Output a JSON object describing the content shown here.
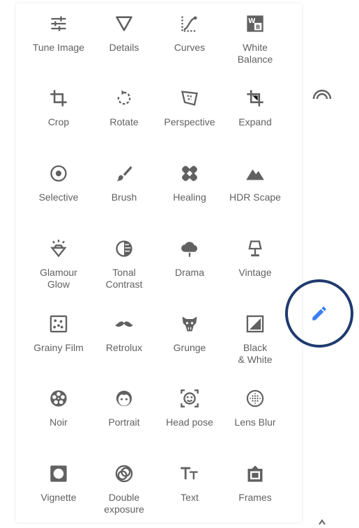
{
  "colors": {
    "icon": "#616161",
    "label": "#616161",
    "accent": "#3d7ff5",
    "circle": "#1f3a6e"
  },
  "tools": [
    {
      "name": "tune-image",
      "label": "Tune Image",
      "icon": "tune-icon"
    },
    {
      "name": "details",
      "label": "Details",
      "icon": "details-triangle-icon"
    },
    {
      "name": "curves",
      "label": "Curves",
      "icon": "curves-icon"
    },
    {
      "name": "white-balance",
      "label": "White\nBalance",
      "icon": "white-balance-icon"
    },
    {
      "name": "crop",
      "label": "Crop",
      "icon": "crop-icon"
    },
    {
      "name": "rotate",
      "label": "Rotate",
      "icon": "rotate-icon"
    },
    {
      "name": "perspective",
      "label": "Perspective",
      "icon": "perspective-icon"
    },
    {
      "name": "expand",
      "label": "Expand",
      "icon": "expand-icon"
    },
    {
      "name": "selective",
      "label": "Selective",
      "icon": "selective-icon"
    },
    {
      "name": "brush",
      "label": "Brush",
      "icon": "brush-icon"
    },
    {
      "name": "healing",
      "label": "Healing",
      "icon": "healing-bandage-icon"
    },
    {
      "name": "hdr-scape",
      "label": "HDR Scape",
      "icon": "mountains-icon"
    },
    {
      "name": "glamour-glow",
      "label": "Glamour\nGlow",
      "icon": "diamond-icon"
    },
    {
      "name": "tonal-contrast",
      "label": "Tonal\nContrast",
      "icon": "tonal-contrast-icon"
    },
    {
      "name": "drama",
      "label": "Drama",
      "icon": "cloud-icon"
    },
    {
      "name": "vintage",
      "label": "Vintage",
      "icon": "lamp-icon"
    },
    {
      "name": "grainy-film",
      "label": "Grainy Film",
      "icon": "grain-icon"
    },
    {
      "name": "retrolux",
      "label": "Retrolux",
      "icon": "mustache-icon"
    },
    {
      "name": "grunge",
      "label": "Grunge",
      "icon": "grunge-icon"
    },
    {
      "name": "black-white",
      "label": "Black\n& White",
      "icon": "black-white-icon"
    },
    {
      "name": "noir",
      "label": "Noir",
      "icon": "film-reel-icon"
    },
    {
      "name": "portrait",
      "label": "Portrait",
      "icon": "face-icon"
    },
    {
      "name": "head-pose",
      "label": "Head pose",
      "icon": "head-pose-icon"
    },
    {
      "name": "lens-blur",
      "label": "Lens Blur",
      "icon": "lens-blur-icon"
    },
    {
      "name": "vignette",
      "label": "Vignette",
      "icon": "vignette-icon"
    },
    {
      "name": "double-exposure",
      "label": "Double\nexposure",
      "icon": "double-exposure-icon"
    },
    {
      "name": "text",
      "label": "Text",
      "icon": "text-icon"
    },
    {
      "name": "frames",
      "label": "Frames",
      "icon": "frames-icon"
    }
  ],
  "side": {
    "styles_icon": "arch-icon",
    "edit_icon": "pencil-icon"
  }
}
